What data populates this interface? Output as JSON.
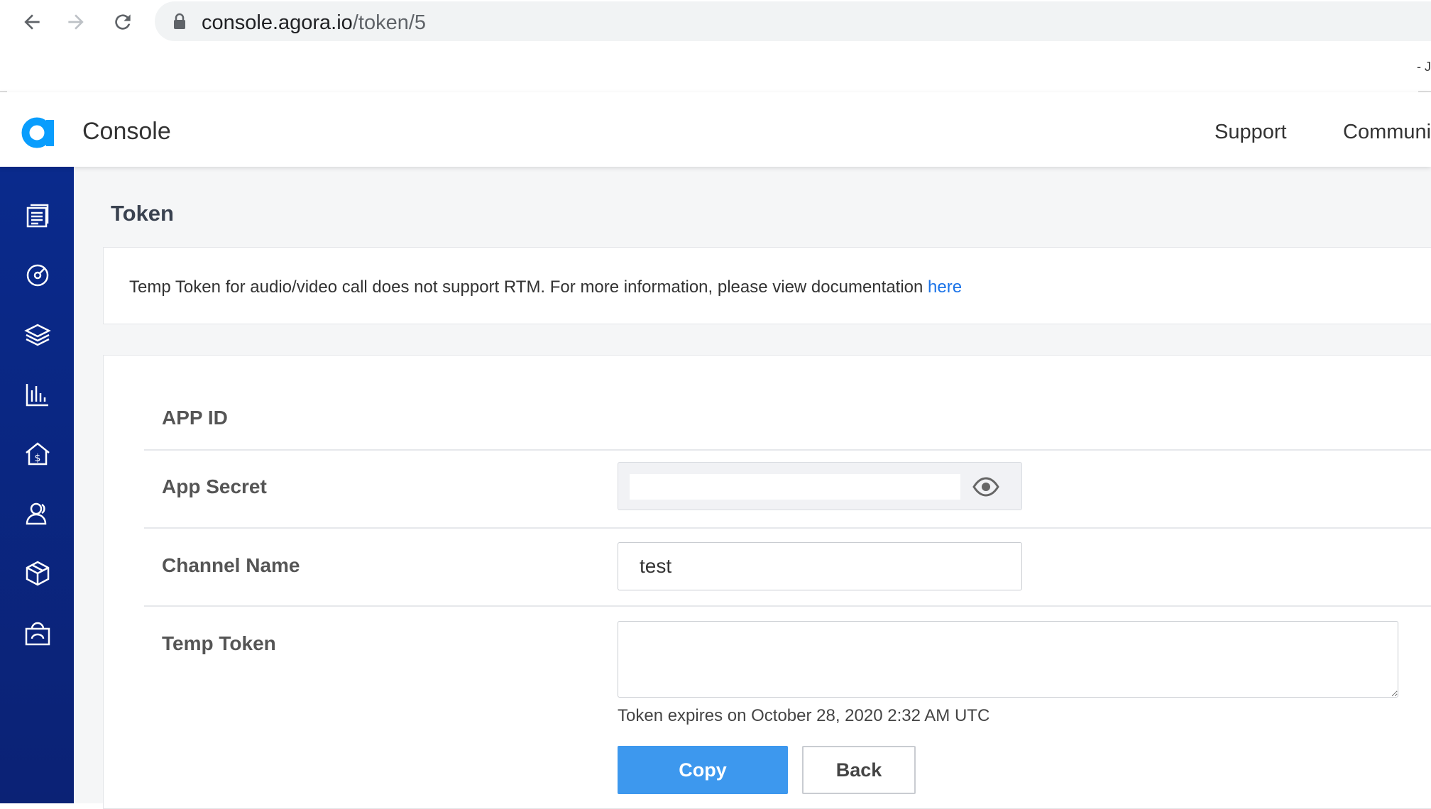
{
  "browser": {
    "url_host": "console.agora.io",
    "url_path": "/token/5",
    "edge_text": "- J"
  },
  "header": {
    "title": "Console",
    "links": [
      "Support",
      "Communi"
    ]
  },
  "sidebar": {
    "items": [
      "projects-icon",
      "dashboard-icon",
      "layers-icon",
      "analytics-icon",
      "billing-icon",
      "members-icon",
      "extensions-icon",
      "marketplace-icon"
    ]
  },
  "page": {
    "title": "Token",
    "notice_text": "Temp Token for audio/video call does not support RTM. For more information, please view documentation ",
    "notice_link": "here"
  },
  "form": {
    "app_id_label": "APP ID",
    "app_secret_label": "App Secret",
    "channel_label": "Channel Name",
    "channel_value": "test",
    "token_label": "Temp Token",
    "token_value": "",
    "expiry_text": "Token expires on October 28, 2020 2:32 AM UTC",
    "copy_label": "Copy",
    "back_label": "Back"
  },
  "colors": {
    "sidebar": "#0a2a8c",
    "primary": "#3d98ee",
    "link": "#1a73e8",
    "logo": "#099dfd"
  }
}
